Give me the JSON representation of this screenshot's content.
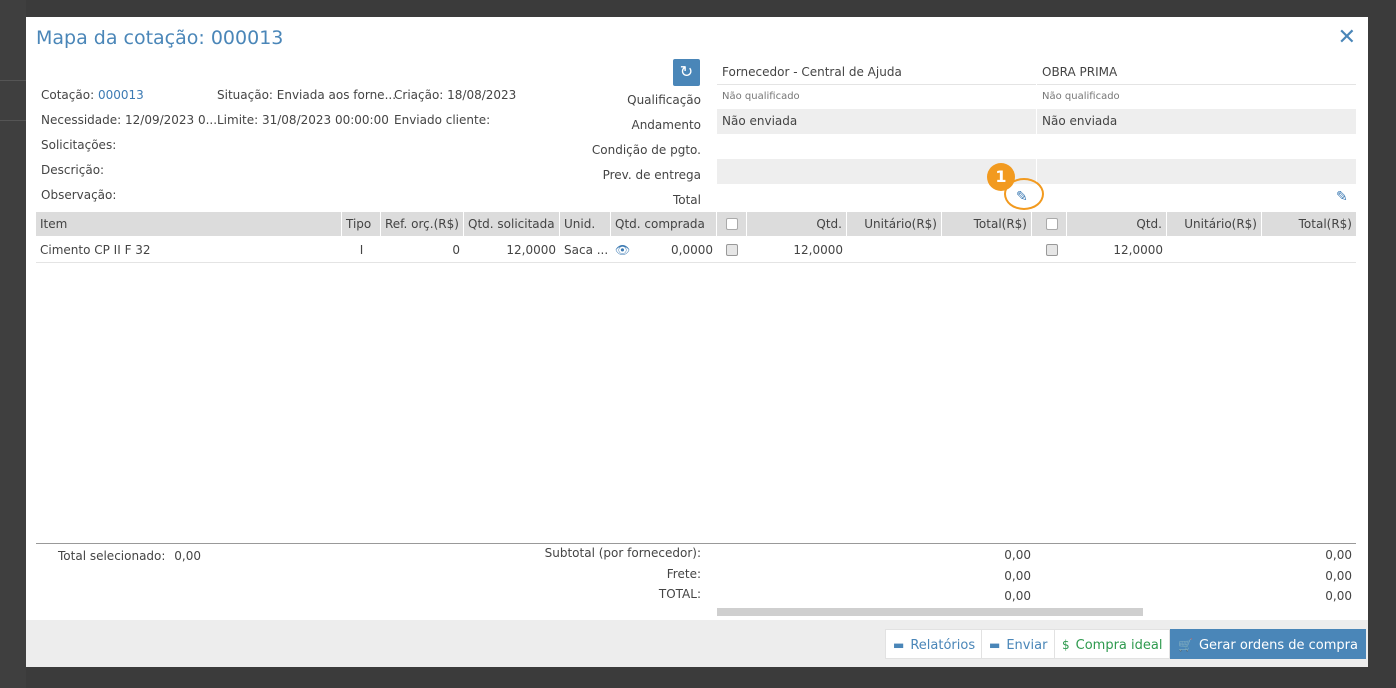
{
  "modal": {
    "title": "Mapa da cotação: 000013",
    "close_glyph": "✕"
  },
  "info": {
    "cotacao_label": "Cotação:",
    "cotacao_value": "000013",
    "situacao": "Situação: Enviada aos forne...",
    "criacao": "Criação: 18/08/2023",
    "necessidade": "Necessidade: 12/09/2023 0...",
    "limite": "Limite: 31/08/2023 00:00:00",
    "enviado_cliente": "Enviado cliente:",
    "solicitacoes": "Solicitações:",
    "descricao": "Descrição:",
    "observacao": "Observação:"
  },
  "row_labels": {
    "qualificacao": "Qualificação",
    "andamento": "Andamento",
    "condicao": "Condição de pgto.",
    "prev_entrega": "Prev. de entrega",
    "total": "Total"
  },
  "suppliers": [
    {
      "name": "Fornecedor - Central de Ajuda",
      "qualificacao": "Não qualificado",
      "andamento": "Não enviada"
    },
    {
      "name": "OBRA PRIMA",
      "qualificacao": "Não qualificado",
      "andamento": "Não enviada"
    }
  ],
  "badge": "1",
  "table": {
    "headers": {
      "item": "Item",
      "tipo": "Tipo",
      "ref": "Ref. orç.(R$)",
      "qtd_solicitada": "Qtd. solicitada",
      "unid": "Unid.",
      "qtd_comprada": "Qtd. comprada",
      "qtd": "Qtd.",
      "unitario": "Unitário(R$)",
      "total": "Total(R$)"
    },
    "rows": [
      {
        "item": "Cimento CP II F 32",
        "tipo": "I",
        "ref": "0",
        "qtd_solicitada": "12,0000",
        "unid": "Saca ...",
        "qtd_comprada": "0,0000",
        "s1_qtd": "12,0000",
        "s2_qtd": "12,0000"
      }
    ]
  },
  "footer": {
    "total_selecionado_label": "Total selecionado:",
    "total_selecionado_value": "0,00",
    "subtotal_label": "Subtotal (por fornecedor):",
    "frete_label": "Frete:",
    "total_label": "TOTAL:",
    "s1": {
      "subtotal": "0,00",
      "frete": "0,00",
      "total": "0,00"
    },
    "s2": {
      "subtotal": "0,00",
      "frete": "0,00",
      "total": "0,00"
    }
  },
  "buttons": {
    "relatorios": "Relatórios",
    "enviar": "Enviar",
    "compra_ideal": "Compra ideal",
    "gerar": "Gerar ordens de compra"
  },
  "icons": {
    "refresh": "refresh-icon",
    "pencil": "pencil-icon",
    "eye": "eye-icon",
    "report": "report-icon",
    "send": "send-icon",
    "dollar": "dollar-icon",
    "cart": "cart-icon"
  },
  "colors": {
    "accent": "#4a86b8",
    "badge": "#f29a1f",
    "green": "#2e9a4e"
  }
}
